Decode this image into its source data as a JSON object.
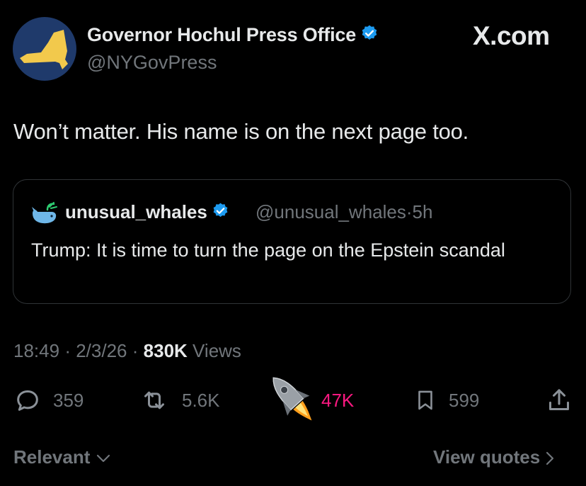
{
  "author": {
    "display_name": "Governor Hochul Press Office",
    "handle": "@NYGovPress",
    "verified": true
  },
  "brand": "X.com",
  "tweet": {
    "text": "Won’t matter. His name is on the next page too."
  },
  "quoted": {
    "display_name": "unusual_whales",
    "handle": "@unusual_whales",
    "time": "5h",
    "separator": "·",
    "text": "Trump: It is time to turn the page on the Epstein scandal"
  },
  "meta": {
    "time": "18:49",
    "date": "2/3/26",
    "separator": "·",
    "views_count": "830K",
    "views_label": "Views"
  },
  "actions": {
    "replies": "359",
    "reposts": "5.6K",
    "likes": "47K",
    "bookmarks": "599"
  },
  "footer": {
    "sort_label": "Relevant",
    "view_quotes": "View quotes"
  },
  "colors": {
    "background": "#000000",
    "text": "#e7e9ea",
    "secondary": "#71767b",
    "verified": "#1d9bf0",
    "like": "#f91880",
    "state_avatar_bg": "#1f3a6b",
    "state_shape": "#f2c94c"
  },
  "icons": {
    "verified": "verified-badge-icon",
    "reply": "reply-bubble-icon",
    "repost": "repost-arrows-icon",
    "like": "rocket-icon",
    "bookmark": "bookmark-icon",
    "share": "share-icon"
  }
}
